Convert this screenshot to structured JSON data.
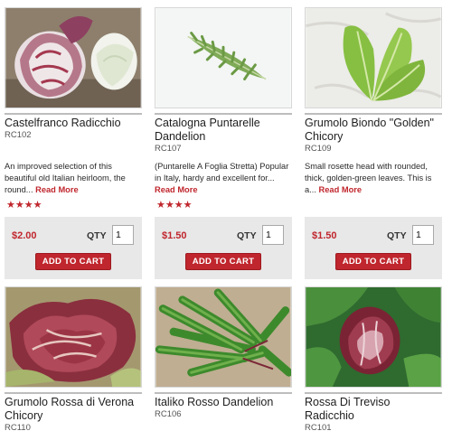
{
  "products": [
    {
      "name": "Castelfranco Radicchio",
      "sku": "RC102",
      "description": "An improved selection of this beautiful old Italian heirloom, the round...",
      "read_more": "Read More",
      "rating": 4,
      "stars": "★★★★",
      "price": "$2.00",
      "qty_label": "QTY",
      "qty": "1",
      "add_to_cart": "ADD TO CART"
    },
    {
      "name": "Catalogna Puntarelle Dandelion",
      "sku": "RC107",
      "description": "(Puntarelle A Foglia Stretta) Popular in Italy, hardy and excellent for...",
      "read_more": "Read More",
      "rating": 4,
      "stars": "★★★★",
      "price": "$1.50",
      "qty_label": "QTY",
      "qty": "1",
      "add_to_cart": "ADD TO CART"
    },
    {
      "name": "Grumolo Biondo \"Golden\" Chicory",
      "sku": "RC109",
      "description": "Small rosette head with rounded, thick, golden-green leaves. This is a...",
      "read_more": "Read More",
      "price": "$1.50",
      "qty_label": "QTY",
      "qty": "1",
      "add_to_cart": "ADD TO CART"
    },
    {
      "name": "Grumolo Rossa di Verona Chicory",
      "sku": "RC110"
    },
    {
      "name": "Italiko Rosso Dandelion",
      "sku": "RC106"
    },
    {
      "name": "Rossa Di Treviso Radicchio",
      "sku": "RC101"
    }
  ]
}
